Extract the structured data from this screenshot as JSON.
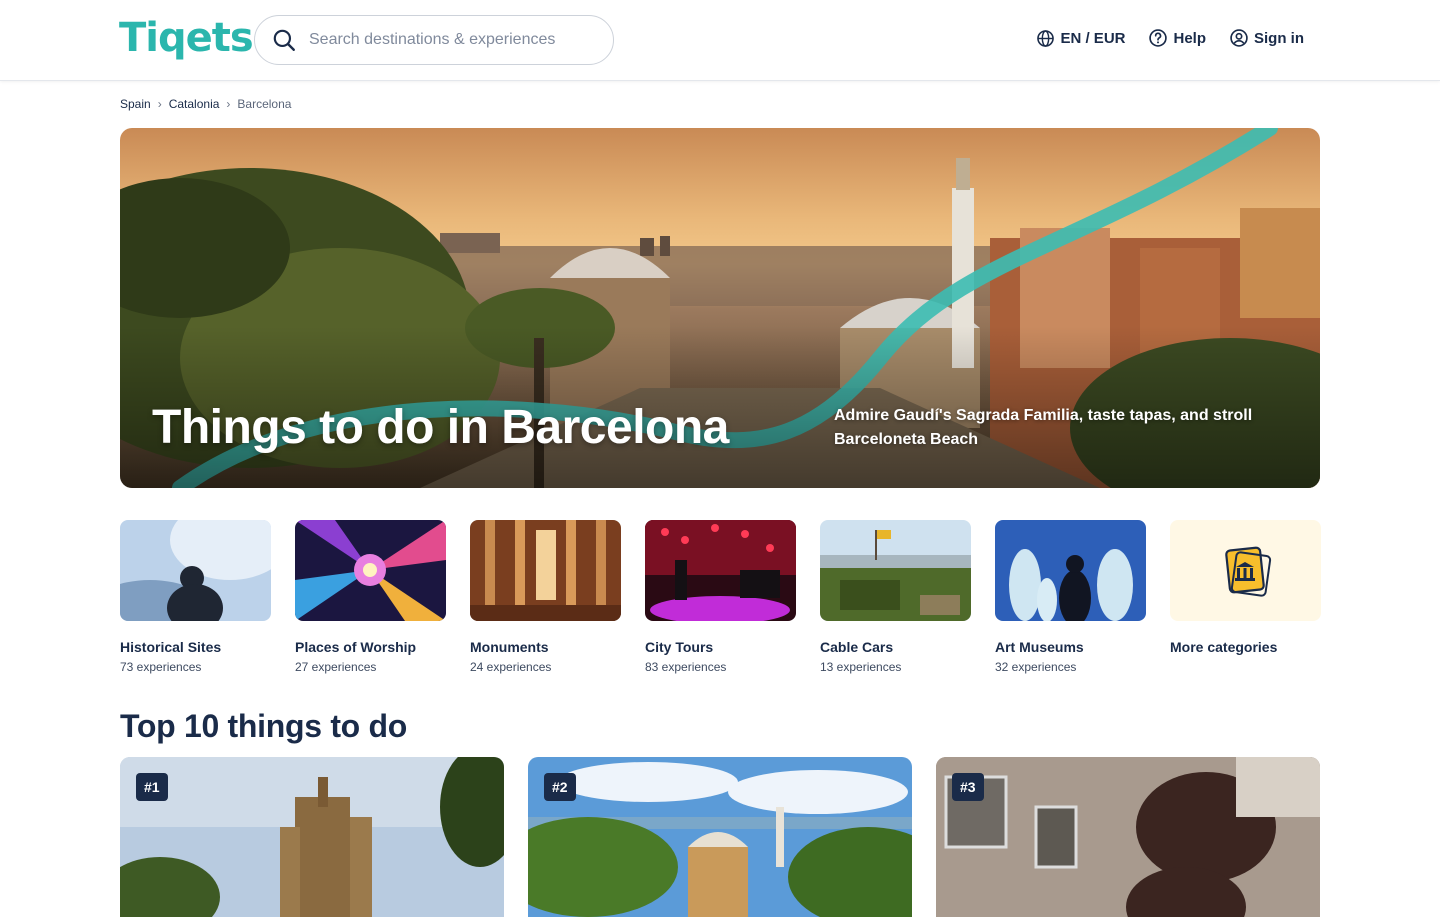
{
  "header": {
    "logo": "Tiqets",
    "search_placeholder": "Search destinations & experiences",
    "nav": {
      "language": "EN / EUR",
      "help": "Help",
      "sign_in": "Sign in"
    }
  },
  "breadcrumb": [
    "Spain",
    "Catalonia",
    "Barcelona"
  ],
  "hero": {
    "title": "Things to do in Barcelona",
    "subtitle": "Admire Gaudí's Sagrada Familia, taste tapas, and stroll Barceloneta Beach"
  },
  "categories": [
    {
      "name": "Historical Sites",
      "count": "73 experiences"
    },
    {
      "name": "Places of Worship",
      "count": "27 experiences"
    },
    {
      "name": "Monuments",
      "count": "24 experiences"
    },
    {
      "name": "City Tours",
      "count": "83 experiences"
    },
    {
      "name": "Cable Cars",
      "count": "13 experiences"
    },
    {
      "name": "Art Museums",
      "count": "32 experiences"
    },
    {
      "name": "More categories",
      "count": ""
    }
  ],
  "top10": {
    "title": "Top 10 things to do",
    "ranks": [
      "#1",
      "#2",
      "#3"
    ]
  },
  "colors": {
    "brand": "#2bb6ad",
    "text": "#1a2b49",
    "rank_badge": "#1a2b49"
  }
}
